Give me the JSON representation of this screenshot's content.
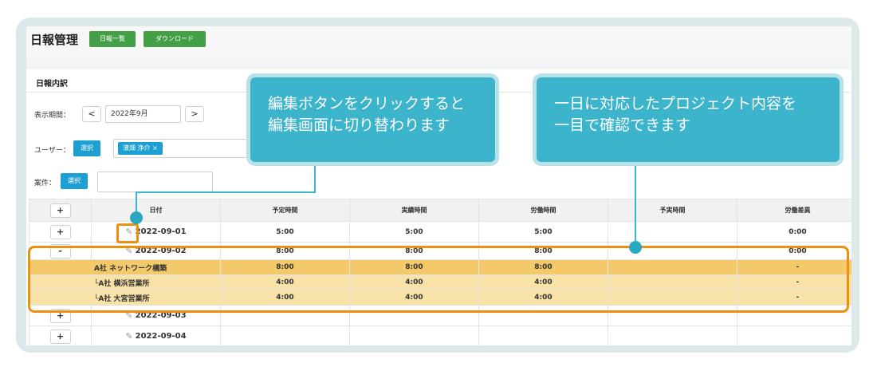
{
  "header": {
    "title": "日報管理",
    "list_button": "日報一覧",
    "download_button": "ダウンロード"
  },
  "section": {
    "title": "日報内訳"
  },
  "filters": {
    "period_label": "表示期間：",
    "prev": "<",
    "month": "2022年9月",
    "next": ">",
    "user_label": "ユーザー：",
    "user_select": "選択",
    "user_tag": "濱畑 浄介",
    "user_tag_remove": "×",
    "case_label": "案件：",
    "case_select": "選択"
  },
  "table": {
    "columns": [
      "日付",
      "予定時間",
      "実績時間",
      "労働時間",
      "予実時間",
      "労働差異"
    ],
    "header_toggle": "+",
    "rows": [
      {
        "toggle": "+",
        "date": "2022-09-01",
        "planned": "5:00",
        "actual": "5:00",
        "labor": "5:00",
        "plan_actual": "",
        "diff": "0:00"
      },
      {
        "toggle": "-",
        "date": "2022-09-02",
        "planned": "8:00",
        "actual": "8:00",
        "labor": "8:00",
        "plan_actual": "",
        "diff": "0:00"
      }
    ],
    "project": {
      "name": "A社 ネットワーク構築",
      "planned": "8:00",
      "actual": "8:00",
      "labor": "8:00",
      "plan_actual": "",
      "diff": "-"
    },
    "subs": [
      {
        "name": "└A社 横浜営業所",
        "planned": "4:00",
        "actual": "4:00",
        "labor": "4:00",
        "plan_actual": "",
        "diff": "-"
      },
      {
        "name": "└A社 大宮営業所",
        "planned": "4:00",
        "actual": "4:00",
        "labor": "4:00",
        "plan_actual": "",
        "diff": "-"
      }
    ],
    "more_rows": [
      {
        "toggle": "+",
        "date": "2022-09-03"
      },
      {
        "toggle": "+",
        "date": "2022-09-04"
      }
    ]
  },
  "callouts": {
    "edit": {
      "line1": "編集ボタンをクリックすると",
      "line2": "編集画面に切り替わります"
    },
    "project": {
      "line1": "一日に対応したプロジェクト内容を",
      "line2": "一目で確認できます"
    }
  },
  "colors": {
    "accent_teal": "#3cb4cb",
    "highlight_orange": "#ef8f10",
    "button_green": "#43a047",
    "button_blue": "#1e9fd2",
    "project_row": "#f3c96a",
    "sub_row": "#f9e2a7"
  },
  "icons": {
    "edit": "pencil-edit-icon"
  }
}
